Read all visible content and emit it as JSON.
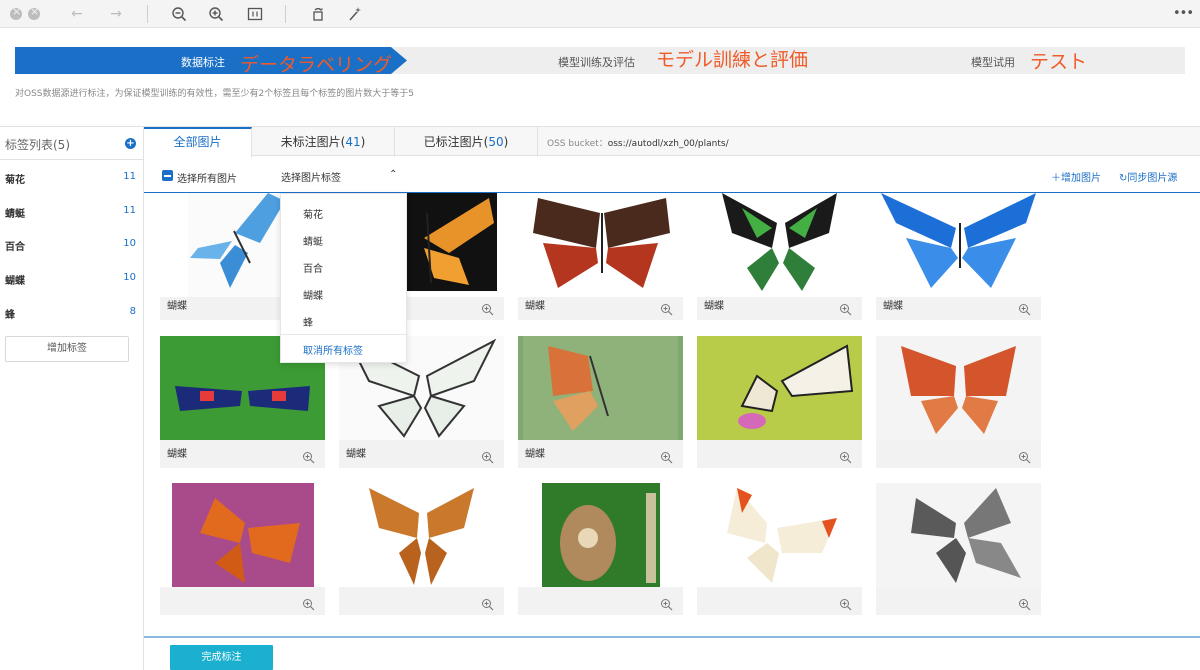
{
  "toolbar": {
    "icons": [
      "close-icon",
      "close-icon",
      "back-arrow-icon",
      "forward-arrow-icon",
      "zoom-out-icon",
      "zoom-in-icon",
      "fit-icon",
      "rotate-icon",
      "magic-wand-icon",
      "more-icon"
    ]
  },
  "steps": {
    "step1_label": "数据标注",
    "step1_jp": "データラベリング",
    "step2_label": "模型训练及评估",
    "step2_jp": "モデル訓練と評価",
    "step3_label": "模型试用",
    "step3_jp": "テスト",
    "hint": "对OSS数据源进行标注，为保证模型训练的有效性，需至少有2个标签且每个标签的图片数大于等于5"
  },
  "sidebar": {
    "title": "标签列表(5)",
    "items": [
      {
        "label": "菊花",
        "count": "11"
      },
      {
        "label": "蜻蜓",
        "count": "11"
      },
      {
        "label": "百合",
        "count": "10"
      },
      {
        "label": "蝴蝶",
        "count": "10"
      },
      {
        "label": "蜂",
        "count": "8"
      }
    ],
    "add_button": "增加标签"
  },
  "tabs": {
    "all": "全部图片",
    "unlabeled_prefix": "未标注图片(",
    "unlabeled_count": "41",
    "labeled_prefix": "已标注图片(",
    "labeled_count": "50",
    "suffix": ")",
    "oss_label": "OSS bucket：",
    "oss_path": "oss://autodl/xzh_00/plants/"
  },
  "actions": {
    "select_all": "选择所有图片",
    "select_tag": "选择图片标签",
    "add_image": "增加图片",
    "sync_source": "同步图片源"
  },
  "dropdown": {
    "items": [
      "菊花",
      "蜻蜓",
      "百合",
      "蝴蝶",
      "蜂"
    ],
    "cancel": "取消所有标签"
  },
  "cards": [
    {
      "label": "蝴蝶"
    },
    {
      "label": ""
    },
    {
      "label": "蝴蝶"
    },
    {
      "label": "蝴蝶"
    },
    {
      "label": "蝴蝶"
    },
    {
      "label": "蝴蝶"
    },
    {
      "label": "蝴蝶"
    },
    {
      "label": "蝴蝶"
    },
    {
      "label": ""
    },
    {
      "label": ""
    },
    {
      "label": ""
    },
    {
      "label": ""
    },
    {
      "label": ""
    },
    {
      "label": ""
    },
    {
      "label": ""
    }
  ],
  "footer": {
    "done_button": "完成标注"
  },
  "colors": {
    "accent": "#1a6fc7",
    "step_annotation": "#f05a28",
    "done_button": "#1bb0cf"
  }
}
